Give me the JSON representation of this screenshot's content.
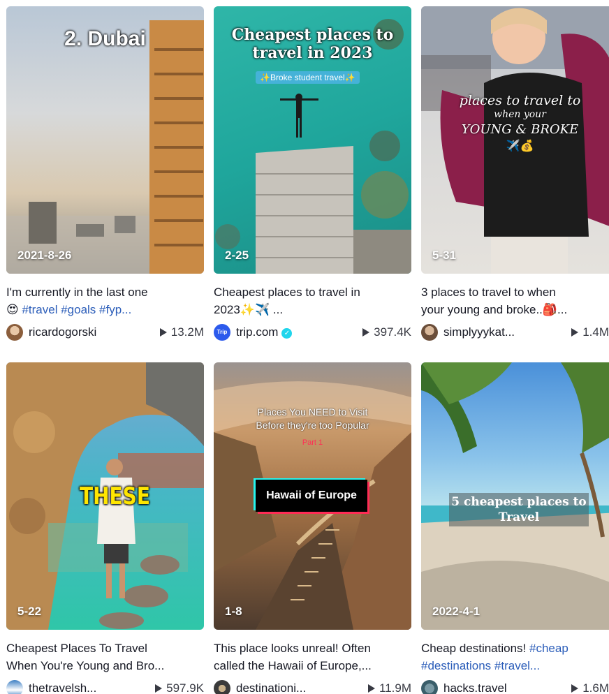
{
  "videos": [
    {
      "overlay": "2. Dubai",
      "date": "2021-8-26",
      "caption_text": "I'm currently in the last one",
      "caption_line2_emoji": "😍",
      "caption_tags": "#travel #goals #fyp...",
      "author": "ricardogorski",
      "views": "13.2M"
    },
    {
      "overlay_title": "Cheapest places to travel in 2023",
      "overlay_sub": "✨Broke student travel✨",
      "date": "2-25",
      "caption_text": "Cheapest places to travel in",
      "caption_line2": "2023✨✈️ ...",
      "author": "trip.com",
      "avatar_text": "Trip",
      "views": "397.4K"
    },
    {
      "overlay_line1": "places to travel to",
      "overlay_line2": "when your",
      "overlay_line3": "YOUNG & BROKE",
      "overlay_line4": "✈️💰",
      "date": "5-31",
      "caption_text": "3 places to travel to when",
      "caption_line2": "your young and broke..🎒...",
      "author": "simplyyykat...",
      "views": "1.4M"
    },
    {
      "overlay": "THESE",
      "date": "5-22",
      "caption_text": "Cheapest Places To Travel",
      "caption_line2": "When You're Young and Bro...",
      "author": "thetravelsh...",
      "views": "597.9K"
    },
    {
      "overlay_line1": "Places You NEED to Visit",
      "overlay_line2": "Before they're too Popular",
      "overlay_part": "Part 1",
      "overlay_box": "Hawaii of Europe",
      "date": "1-8",
      "caption_text": "This place looks unreal! Often",
      "caption_line2": "called the Hawaii of Europe,...",
      "author": "destinationi...",
      "views": "11.9M"
    },
    {
      "overlay_line1": "5 cheapest places to",
      "overlay_line2": "Travel",
      "date": "2022-4-1",
      "caption_text": "Cheap destinations! ",
      "caption_tag1": "#cheap",
      "caption_tags2": "#destinations #travel...",
      "author": "hacks.travel",
      "views": "1.6M"
    }
  ],
  "colors": {
    "hashtag": "#2b5db9",
    "verified": "#20d5ec",
    "text": "#161823"
  },
  "icons": [
    "play-icon",
    "verified-icon",
    "avatar"
  ]
}
